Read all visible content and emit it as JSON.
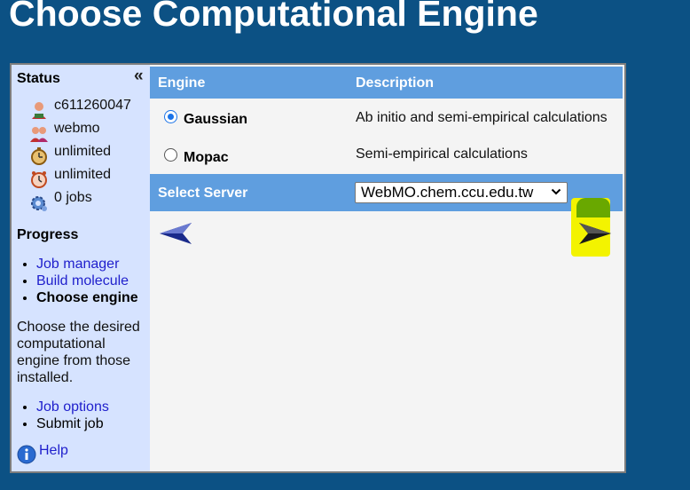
{
  "page": {
    "title": "Choose Computational Engine"
  },
  "sidebar": {
    "status_heading": "Status",
    "collapse_glyph": "«",
    "status_items": [
      {
        "icon": "user-icon",
        "text": "c611260047"
      },
      {
        "icon": "group-icon",
        "text": "webmo"
      },
      {
        "icon": "time-limit-icon",
        "text": "unlimited"
      },
      {
        "icon": "clock-icon",
        "text": "unlimited"
      },
      {
        "icon": "jobs-gear-icon",
        "text": "0 jobs"
      }
    ],
    "progress_heading": "Progress",
    "steps": [
      {
        "label": "Job manager",
        "link": true
      },
      {
        "label": "Build molecule",
        "link": true
      },
      {
        "label": "Choose engine",
        "current": true
      }
    ],
    "description": "Choose the desired computational engine from those installed.",
    "next_steps": [
      {
        "label": "Job options",
        "link": true
      },
      {
        "label": "Submit job",
        "link": false
      }
    ],
    "help_label": "Help"
  },
  "table": {
    "col_engine": "Engine",
    "col_description": "Description",
    "engines": [
      {
        "name": "Gaussian",
        "description": "Ab initio and semi-empirical calculations",
        "selected": true
      },
      {
        "name": "Mopac",
        "description": "Semi-empirical calculations",
        "selected": false
      }
    ],
    "server_label": "Select Server",
    "server_value": "WebMO.chem.ccu.edu.tw"
  },
  "colors": {
    "background": "#0c5184",
    "header": "#5f9edf",
    "sidebar": "#d6e3ff",
    "highlight": "#f3f300"
  }
}
